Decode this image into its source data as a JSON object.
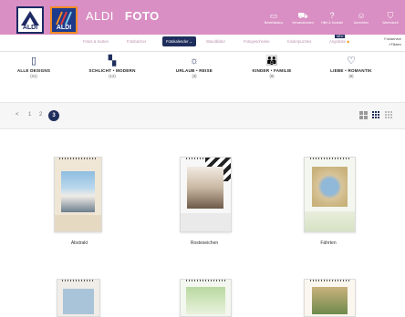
{
  "header": {
    "logo_text": "ALDI",
    "logo2_text": "ALDI",
    "brand_name": "ALDI",
    "section": "FOTO",
    "icons": [
      {
        "label": "Bestellstatus",
        "icon": "order-icon"
      },
      {
        "label": "Versandkosten",
        "icon": "truck-icon"
      },
      {
        "label": "Hilfe & Kontakt",
        "icon": "help-icon"
      },
      {
        "label": "Anmelden",
        "icon": "user-icon"
      },
      {
        "label": "Warenkorb",
        "icon": "cart-icon"
      }
    ]
  },
  "nav": {
    "items": [
      "Fotos & Karten",
      "Fotobücher",
      "Fotokalender",
      "Wandbilder",
      "Fotogeschenke",
      "Kinderpuzzles",
      "Angebote"
    ],
    "active": "Fotokalender",
    "new_badge": "NEU",
    "right_text": "Fotoservice",
    "right_text2": "Filialen"
  },
  "categories": [
    {
      "name": "ALLE DESIGNS",
      "count": "(31)",
      "icon": "calendar-icon"
    },
    {
      "name": "SCHLICHT • MODERN",
      "count": "(12)",
      "icon": "square-icon"
    },
    {
      "name": "URLAUB • REISE",
      "count": "(3)",
      "icon": "sun-icon"
    },
    {
      "name": "KINDER • FAMILIE",
      "count": "(9)",
      "icon": "family-icon"
    },
    {
      "name": "LIEBE • ROMANTIK",
      "count": "(6)",
      "icon": "heart-icon"
    }
  ],
  "pagination": {
    "prev": "<",
    "pages": [
      "1",
      "2",
      "3"
    ],
    "current": "3"
  },
  "products": [
    {
      "name": "Abstrakt"
    },
    {
      "name": "Rosteseichen"
    },
    {
      "name": "Fährten"
    }
  ],
  "colors": {
    "header_bg": "#d98fc3",
    "nav_active": "#1f2e5c",
    "accent": "#1f2e5c"
  }
}
